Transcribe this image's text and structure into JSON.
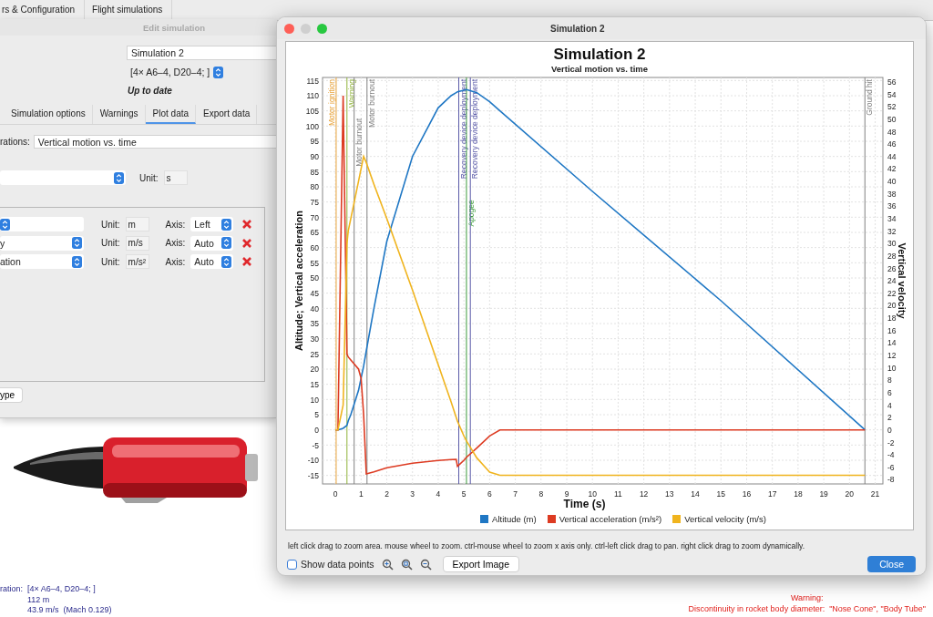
{
  "main_tabs": [
    {
      "label": "rs & Configuration"
    },
    {
      "label": "Flight simulations"
    }
  ],
  "edit_dialog": {
    "title": "Edit simulation",
    "name_field": "Simulation 2",
    "configuration": "[4× A6–4, D20–4; ]",
    "status": "Up to date",
    "tabs": [
      {
        "label": "Simulation options",
        "selected": false
      },
      {
        "label": "Warnings",
        "selected": false
      },
      {
        "label": "Plot data",
        "selected": true
      },
      {
        "label": "Export data",
        "selected": false
      }
    ],
    "template_label": "rations:",
    "template": "Vertical motion vs. time",
    "domain": {
      "unit_label": "Unit:",
      "unit": "s"
    },
    "rows": [
      {
        "unit_label": "Unit:",
        "unit": "m",
        "axis_label": "Axis:",
        "axis": "Left"
      },
      {
        "type": "y",
        "unit_label": "Unit:",
        "unit": "m/s",
        "axis_label": "Axis:",
        "axis": "Auto"
      },
      {
        "type": "ation",
        "unit_label": "Unit:",
        "unit": "m/s²",
        "axis_label": "Axis:",
        "axis": "Auto"
      }
    ],
    "button": "ype"
  },
  "info": [
    {
      "label": "ration:",
      "value": "[4× A6–4, D20–4; ]"
    },
    {
      "value": "112 m"
    },
    {
      "value": "43.9 m/s  (Mach 0.129)"
    }
  ],
  "warning": {
    "title": "Warning:",
    "text": "Discontinuity in rocket body diameter:  \"Nose Cone\", \"Body Tube\""
  },
  "plot_window": {
    "title": "Simulation 2",
    "chart_data": {
      "type": "line",
      "title": "Simulation 2",
      "subtitle": "Vertical motion vs. time",
      "xlabel": "Time (s)",
      "ylabel": "Altitude; Vertical acceleration",
      "y2label": "Vertical velocity",
      "x": [
        0,
        0.1,
        0.3,
        0.45,
        0.5,
        0.6,
        0.9,
        1.0,
        1.1,
        1.2,
        1.5,
        2,
        3,
        4,
        4.5,
        4.7,
        4.75,
        5,
        5.1,
        5.5,
        6,
        6.4,
        10,
        15,
        20.6
      ],
      "series": [
        {
          "name": "Altitude (m)",
          "color": "#1f77c4",
          "values": [
            0,
            0,
            0.5,
            1.5,
            3,
            5,
            13,
            17,
            21,
            26,
            40,
            62,
            90,
            106,
            110,
            111,
            111.3,
            111.8,
            112,
            111,
            108,
            105,
            78.5,
            42.5,
            0
          ]
        },
        {
          "name": "Vertical acceleration (m/s²)",
          "color": "#dd3b22",
          "values": [
            0,
            0,
            110,
            25,
            24,
            23,
            20,
            17,
            5,
            -14.5,
            -13.8,
            -12.5,
            -11,
            -10.1,
            -9.8,
            -9.7,
            -12,
            -10,
            -9,
            -6,
            -2,
            0,
            0,
            0,
            0
          ]
        },
        {
          "name": "Vertical velocity (m/s)",
          "color": "#f0b41e",
          "axis": "y2",
          "values": [
            0,
            0,
            4,
            30,
            32,
            34,
            40,
            42,
            44,
            43,
            39.5,
            34,
            22.5,
            10.5,
            4.5,
            2,
            1.4,
            -1,
            -1.8,
            -4.5,
            -6.8,
            -7.3,
            -7.3,
            -7.3,
            -7.3
          ]
        }
      ],
      "xlim": [
        -0.5,
        21.3
      ],
      "ylim": [
        -17.8,
        116
      ],
      "y2lim": [
        -8.7,
        56.7
      ],
      "xticks": [
        0,
        1,
        2,
        3,
        4,
        5,
        6,
        7,
        8,
        9,
        10,
        11,
        12,
        13,
        14,
        15,
        16,
        17,
        18,
        19,
        20,
        21
      ],
      "yticks": [
        -15,
        -10,
        -5,
        0,
        5,
        10,
        15,
        20,
        25,
        30,
        35,
        40,
        45,
        50,
        55,
        60,
        65,
        70,
        75,
        80,
        85,
        90,
        95,
        100,
        105,
        110,
        115
      ],
      "y2ticks": [
        -8,
        -6,
        -4,
        -2,
        0,
        2,
        4,
        6,
        8,
        10,
        12,
        14,
        16,
        18,
        20,
        22,
        24,
        26,
        28,
        30,
        32,
        34,
        36,
        38,
        40,
        42,
        44,
        46,
        48,
        50,
        52,
        54,
        56
      ],
      "grid": true,
      "legend": "bottom",
      "ref_lines": [
        {
          "axis": "x",
          "value": 0.03,
          "label": "Motor ignition",
          "color": "#e8a33a"
        },
        {
          "axis": "x",
          "value": 0.45,
          "label": "Warning",
          "color": "#8fb33a"
        },
        {
          "axis": "x",
          "value": 0.73,
          "label": "Motor burnout",
          "color": "#808080"
        },
        {
          "axis": "x",
          "value": 1.23,
          "label": "Motor burnout",
          "color": "#808080"
        },
        {
          "axis": "x",
          "value": 4.8,
          "label": "Recovery device deployment",
          "color": "#5a5aa8"
        },
        {
          "axis": "x",
          "value": 5.1,
          "label": "Apogee",
          "color": "#3a9a3a"
        },
        {
          "axis": "x",
          "value": 5.25,
          "label": "Recovery device deployment",
          "color": "#5a5aa8"
        },
        {
          "axis": "x",
          "value": 20.6,
          "label": "Ground hit",
          "color": "#808080"
        }
      ]
    },
    "hint": "left click drag to zoom area. mouse wheel to zoom. ctrl-mouse wheel to zoom x axis only. ctrl-left click drag to pan.  right click drag to zoom dynamically.",
    "show_data_points": {
      "label": "Show data points",
      "checked": false
    },
    "export_button": "Export Image",
    "close_button": "Close"
  }
}
